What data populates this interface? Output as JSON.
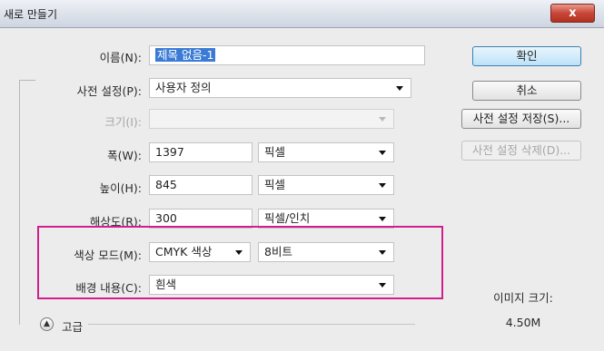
{
  "window": {
    "title": "새로 만들기",
    "close_label": "x"
  },
  "form": {
    "name_label": "이름(N):",
    "name_value": "제목 없음-1",
    "preset_label": "사전 설정(P):",
    "preset_value": "사용자 정의",
    "size_label": "크기(I):",
    "size_value": "",
    "width_label": "폭(W):",
    "width_value": "1397",
    "width_unit": "픽셀",
    "height_label": "높이(H):",
    "height_value": "845",
    "height_unit": "픽셀",
    "resolution_label": "해상도(R):",
    "resolution_value": "300",
    "resolution_unit": "픽셀/인치",
    "color_mode_label": "색상 모드(M):",
    "color_mode_value": "CMYK 색상",
    "bit_depth_value": "8비트",
    "background_label": "배경 내용(C):",
    "background_value": "흰색",
    "advanced_label": "고급"
  },
  "buttons": {
    "ok": "확인",
    "cancel": "취소",
    "save_preset": "사전 설정 저장(S)...",
    "delete_preset": "사전 설정 삭제(D)..."
  },
  "info": {
    "image_size_label": "이미지 크기:",
    "image_size_value": "4.50M"
  },
  "colors": {
    "highlight": "#d0208d",
    "selection": "#3a7bd5"
  }
}
